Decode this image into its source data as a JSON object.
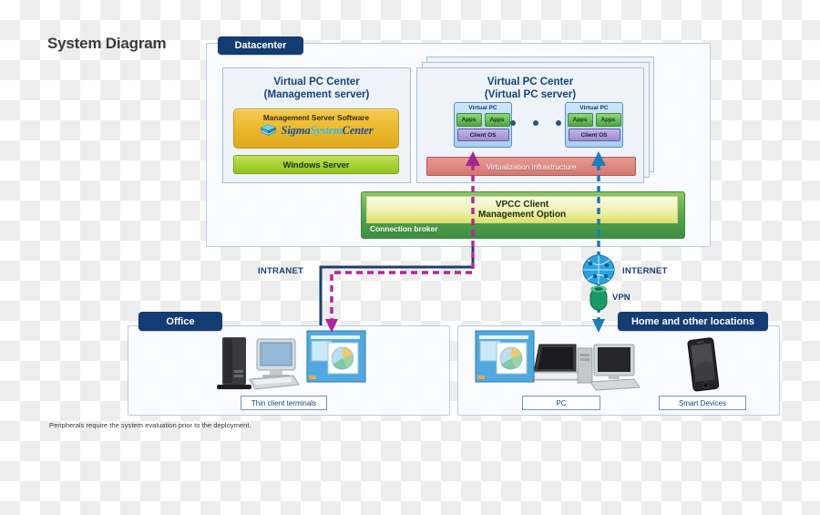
{
  "title": "System Diagram",
  "zones": {
    "datacenter": "Datacenter",
    "office": "Office",
    "home": "Home and other locations"
  },
  "management_server": {
    "title_line1": "Virtual PC Center",
    "title_line2": "(Management server)",
    "software_caption": "Management Server Software",
    "product_parts": [
      "Sigma",
      "System",
      "Center"
    ],
    "product_name": "SigmaSystemCenter",
    "os": "Windows Server"
  },
  "virtual_pc_server": {
    "title_line1": "Virtual PC Center",
    "title_line2": "(Virtual PC server)",
    "vm_caption": "Virtual PC",
    "app_label": "Apps",
    "client_os": "Client OS",
    "infrastructure": "Virtualization infrastructure",
    "ellipsis_dots": 3,
    "stacked_panels": 3
  },
  "broker": {
    "option_line1": "VPCC Client",
    "option_line2": "Management Option",
    "broker_label": "Connection broker"
  },
  "network": {
    "intranet": "INTRANET",
    "internet": "INTERNET",
    "vpn": "VPN"
  },
  "devices": {
    "thin_client": "Thin client terminals",
    "pc": "PC",
    "smart_devices": "Smart Devices"
  },
  "footnote": "Peripherals require the system evaluation prior to the deployment.",
  "colors": {
    "navy": "#133c72",
    "magenta": "#b5259a",
    "blue_dash": "#1579b8",
    "green": "#4fa04a",
    "gold": "#ecbb2f",
    "red": "#d4786f"
  }
}
